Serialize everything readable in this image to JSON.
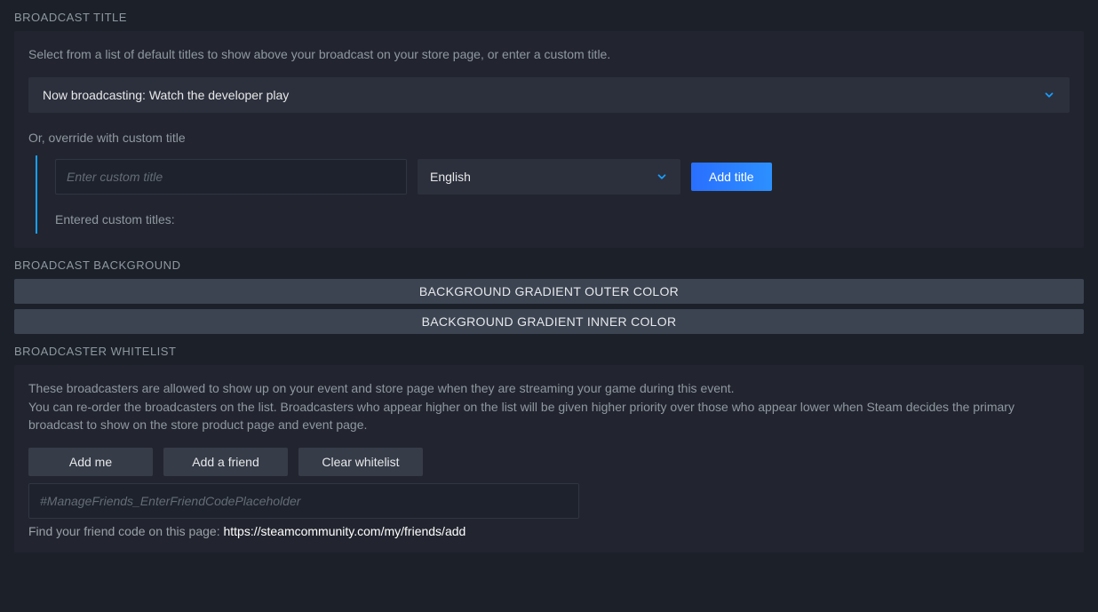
{
  "broadcast_title": {
    "section": "BROADCAST TITLE",
    "help": "Select from a list of default titles to show above your broadcast on your store page, or enter a custom title.",
    "selected": "Now broadcasting: Watch the developer play",
    "or_label": "Or, override with custom title",
    "custom_placeholder": "Enter custom title",
    "language": "English",
    "add_title": "Add title",
    "entered_label": "Entered custom titles:"
  },
  "broadcast_background": {
    "section": "BROADCAST BACKGROUND",
    "outer": "BACKGROUND GRADIENT OUTER COLOR",
    "inner": "BACKGROUND GRADIENT INNER COLOR"
  },
  "whitelist": {
    "section": "BROADCASTER WHITELIST",
    "help1": "These broadcasters are allowed to show up on your event and store page when they are streaming your game during this event.",
    "help2": "You can re-order the broadcasters on the list. Broadcasters who appear higher on the list will be given higher priority over those who appear lower when Steam decides the primary broadcast to show on the store product page and event page.",
    "add_me": "Add me",
    "add_friend": "Add a friend",
    "clear": "Clear whitelist",
    "friend_placeholder": "#ManageFriends_EnterFriendCodePlaceholder",
    "friend_help_prefix": "Find your friend code on this page: ",
    "friend_help_link": "https://steamcommunity.com/my/friends/add"
  }
}
